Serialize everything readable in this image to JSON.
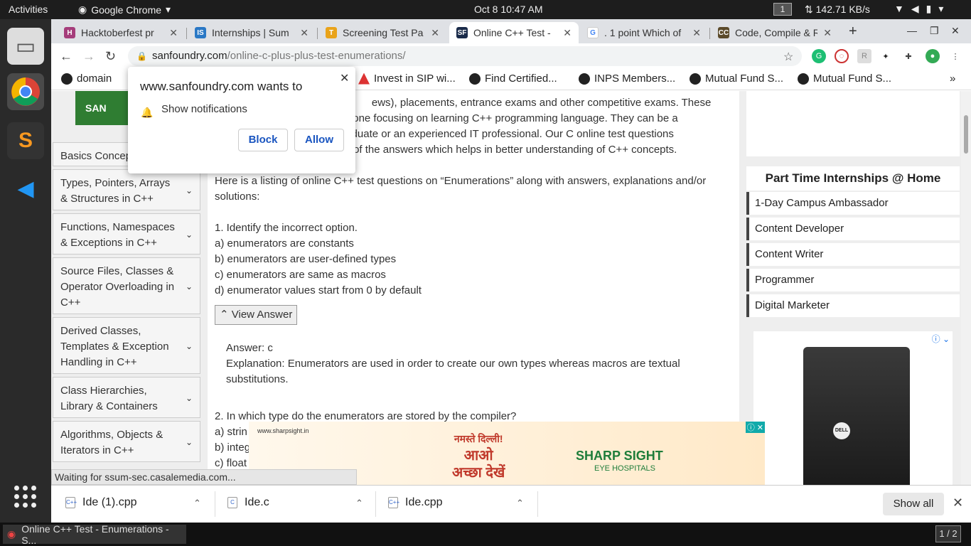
{
  "topbar": {
    "activities": "Activities",
    "app_name": "Google Chrome",
    "clock": "Oct 8  10:47 AM",
    "workspace": "1",
    "network_speed": "142.71 KB/s"
  },
  "tabs": [
    {
      "title": "Hacktoberfest pr",
      "icon_color": "#a53d7b",
      "icon": "hacktoberfest-icon"
    },
    {
      "title": "Internships | Sum",
      "icon_color": "#2a78c5",
      "icon": "internshala-icon"
    },
    {
      "title": "Screening Test Pa",
      "icon_color": "#e9a31a",
      "icon": "screening-icon"
    },
    {
      "title": "Online C++ Test - ",
      "icon_color": "#1a2b4a",
      "icon": "sanfoundry-icon",
      "active": true
    },
    {
      "title": ". 1 point Which of",
      "icon_color": "#ffffff",
      "icon": "google-icon"
    },
    {
      "title": "Code, Compile & R",
      "icon_color": "#5b4a2a",
      "icon": "codechef-icon"
    }
  ],
  "address": {
    "domain": "sanfoundry.com",
    "path": "/online-c-plus-plus-test-enumerations/"
  },
  "bookmarks": [
    "domain",
    "Invest in SIP wi...",
    "Find Certified...",
    "INPS Members...",
    "Mutual Fund S...",
    "Mutual Fund S..."
  ],
  "popup": {
    "title": "www.sanfoundry.com wants to",
    "message": "Show notifications",
    "block": "Block",
    "allow": "Allow"
  },
  "sidebar": {
    "logo_text": "SAN",
    "categories": [
      "Basics Concep",
      "Types, Pointers, Arrays & Structures in C++",
      "Functions, Namespaces & Exceptions in C++",
      "Source Files, Classes & Operator Overloading in C++",
      "Derived Classes, Templates & Exception Handling in C++",
      "Class Hierarchies, Library & Containers",
      "Algorithms, Objects & Iterators in C++"
    ]
  },
  "main": {
    "intro1": "                                                     ews), placements, entrance exams and other competitive exams. These",
    "intro2": "                                    by anyone focusing on learning C++ programming language. They can be a",
    "intro3": "                                    ng graduate or an experienced IT professional. Our C online test questions",
    "intro4": "                                    nation of the answers which helps in better understanding of C++ concepts.",
    "listing": "Here is a listing of online C++ test questions on “Enumerations” along with answers, explanations and/or solutions:",
    "q1": "1. Identify the incorrect option.",
    "q1a": "a) enumerators are constants",
    "q1b": "b) enumerators are user-defined types",
    "q1c": "c) enumerators are same as macros",
    "q1d": "d) enumerator values start from 0 by default",
    "view_answer": "View Answer",
    "answer": "Answer: c",
    "explanation": "Explanation: Enumerators are used in order to create our own types whereas macros are textual substitutions.",
    "q2": "2. In which type do the enumerators are stored by the compiler?",
    "q2a": "a) strin",
    "q2b": "b) integ",
    "q2c": "c) float"
  },
  "right": {
    "heading": "Part Time Internships @ Home",
    "items": [
      "1-Day Campus Ambassador",
      "Content Developer",
      "Content Writer",
      "Programmer",
      "Digital Marketer"
    ]
  },
  "banner": {
    "site": "www.sharpsight.in",
    "hindi_line1": "नमस्ते दिल्ली!",
    "hindi_line2": "आओ",
    "hindi_line3": "अच्छा देखें",
    "brand": "SHARP SIGHT",
    "brand_sub": "EYE HOSPITALS"
  },
  "status": "Waiting for ssum-sec.casalemedia.com...",
  "downloads": {
    "items": [
      "Ide (1).cpp",
      "Ide.c",
      "Ide.cpp"
    ],
    "show_all": "Show all"
  },
  "taskbar": {
    "window": "Online C++ Test - Enumerations - S...",
    "pager": "1 / 2"
  }
}
